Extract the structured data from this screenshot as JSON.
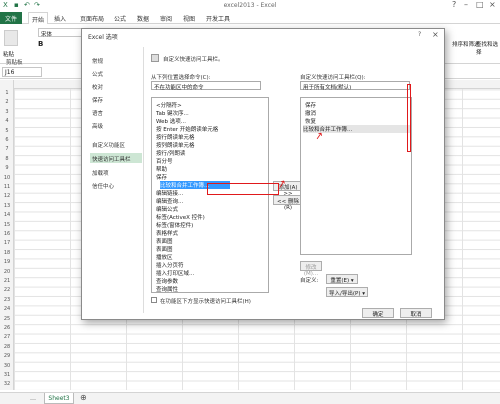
{
  "window": {
    "title": "excel2013 - Excel"
  },
  "tabs": [
    "文件",
    "开始",
    "插入",
    "页面布局",
    "公式",
    "数据",
    "审阅",
    "视图",
    "开发工具"
  ],
  "ribbon": {
    "font": "宋体",
    "size": "11",
    "groups": [
      "剪贴板",
      "字体"
    ],
    "paste": "粘贴",
    "format": "格式",
    "clipboard": "剪贴板",
    "sort": "排序和筛选",
    "find": "查找和选择"
  },
  "formula": {
    "namebox": "J16"
  },
  "rows": [
    "1",
    "2",
    "3",
    "4",
    "5",
    "6",
    "7",
    "8",
    "9",
    "10",
    "11",
    "12",
    "13",
    "14",
    "15",
    "16",
    "17",
    "18",
    "19",
    "20",
    "21",
    "22",
    "23",
    "24",
    "25",
    "26",
    "27",
    "28",
    "29",
    "30",
    "31",
    "32"
  ],
  "sheet_tab": "Sheet3",
  "dialog": {
    "title": "Excel 选项",
    "nav": [
      "常规",
      "公式",
      "校对",
      "保存",
      "语言",
      "高级",
      "自定义功能区",
      "快速访问工具栏",
      "加载项",
      "信任中心"
    ],
    "heading": "自定义快速访问工具栏。",
    "from_label": "从下列位置选择命令(C):",
    "from_value": "不在功能区中的命令",
    "target_label": "自定义快速访问工具栏(Q):",
    "target_value": "用于所有文档(默认)",
    "commands": [
      "<分隔符>",
      "Tab 键次序...",
      "Web 选项...",
      "按 Enter 开始朗读单元格",
      "按行朗读单元格",
      "按列朗读单元格",
      "按行/列朗读",
      "百分号",
      "帮助",
      "保存",
      "比较和合并工作簿...",
      "编辑链接...",
      "编辑查询...",
      "编辑公式",
      "标签(ActiveX 控件)",
      "标签(窗体控件)",
      "表格样式",
      "表面图",
      "表面图",
      "播放区",
      "插入分页符",
      "插入打印区域...",
      "查询参数",
      "查询属性"
    ],
    "selected_command": "比较和合并工作簿...",
    "qat_items": [
      "保存",
      "撤消",
      "恢复",
      "比较和合并工作簿..."
    ],
    "add_btn": "添加(A) >>",
    "remove_btn": "<< 删除(R)",
    "modify_btn": "修改(M)...",
    "custom_label": "自定义:",
    "reset_btn": "重置(E) ▾",
    "import_btn": "导入/导出(P) ▾",
    "show_below": "在功能区下方显示快速访问工具栏(H)",
    "ok": "确定",
    "cancel": "取消"
  }
}
